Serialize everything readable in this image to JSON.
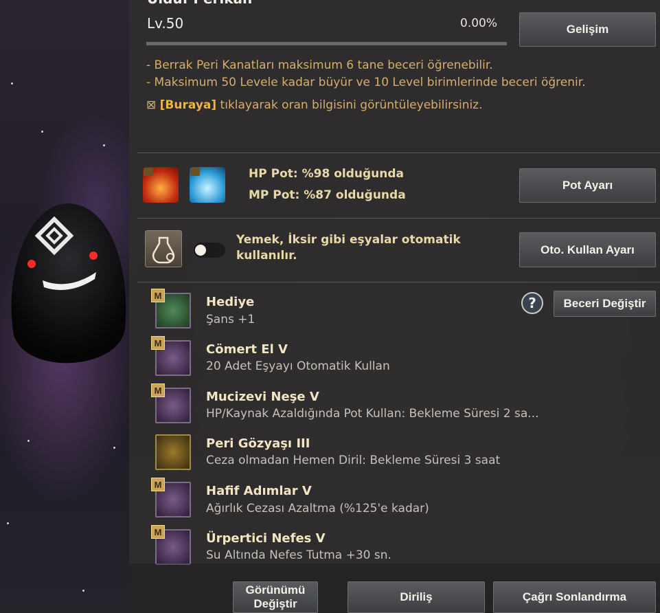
{
  "header": {
    "title": "Ulduf Perikan",
    "level": "Lv.50",
    "progress_text": "0.00%",
    "progress_value": 0,
    "upgrade_button": "Gelişim"
  },
  "notes": {
    "line1": "- Berrak Peri Kanatları maksimum 6 tane beceri öğrenebilir.",
    "line2": "- Maksimum 50 Levele kadar büyür ve 10 Level birimlerinde beceri öğrenir.",
    "link_prefix": "⊠",
    "link_text": "[Buraya]",
    "link_suffix": " tıklayarak oran bilgisini görüntüleyebilirsiniz."
  },
  "potion": {
    "hp_text": "HP Pot: %98 olduğunda",
    "mp_text": "MP Pot: %87 olduğunda",
    "button": "Pot Ayarı",
    "hp_icon": "hp-potion-icon",
    "mp_icon": "mp-potion-icon"
  },
  "auto_use": {
    "text_line1": "Yemek, İksir gibi eşyalar otomatik",
    "text_line2": "kullanılır.",
    "toggle_on": false,
    "button": "Oto. Kullan Ayarı"
  },
  "skills_panel": {
    "help_label": "?",
    "change_button": "Beceri Değiştir",
    "badge": "M",
    "items": [
      {
        "name": "Hediye",
        "desc": "Şans +1",
        "icon": "clover-icon",
        "color": "#3a6a40",
        "badge": true
      },
      {
        "name": "Cömert El V",
        "desc": "20 Adet Eşyayı Otomatik Kullan",
        "icon": "fairy-icon",
        "color": "#4a3352",
        "badge": true
      },
      {
        "name": "Mucizevi Neşe V",
        "desc": "HP/Kaynak Azaldığında Pot Kullan: Bekleme Süresi 2 sa...",
        "icon": "potions-icon",
        "color": "#4a3352",
        "badge": true
      },
      {
        "name": "Peri Gözyaşı III",
        "desc": "Ceza olmadan Hemen Diril: Bekleme Süresi 3 saat",
        "icon": "tear-flask-icon",
        "color": "#4e4020",
        "badge": false
      },
      {
        "name": "Hafif Adımlar V",
        "desc": "Ağırlık Cezası Azaltma (%125'e kadar)",
        "icon": "weight-icon",
        "color": "#4a3352",
        "badge": true
      },
      {
        "name": "Ürpertici Nefes V",
        "desc": "Su Altında Nefes Tutma +30 sn.",
        "icon": "bubble-timer-icon",
        "color": "#4a3352",
        "badge": true
      }
    ]
  },
  "footer": {
    "appearance_line1": "Görünümü",
    "appearance_line2": "Değiştir",
    "revive": "Diriliş",
    "end_summon": "Çağrı Sonlandırma"
  },
  "colors": {
    "accent_gold": "#f1b43c",
    "desc_gold": "#d6ae6d",
    "panel_bg": "#302e2e"
  }
}
